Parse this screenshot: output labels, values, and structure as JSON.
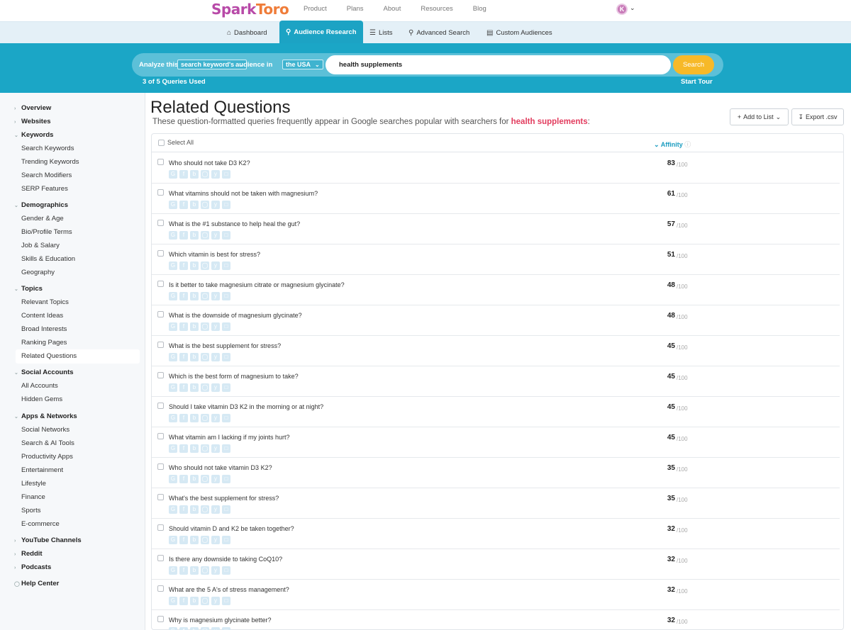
{
  "brand": {
    "logo_part1": "Spark",
    "logo_part2": "Toro"
  },
  "topnav": {
    "links": [
      "Product",
      "Plans",
      "About",
      "Resources",
      "Blog"
    ],
    "avatar_initial": "K"
  },
  "subnav": {
    "tabs": [
      {
        "label": "Dashboard",
        "icon": "home-icon",
        "active": false
      },
      {
        "label": "Audience Research",
        "icon": "user-search-icon",
        "active": true
      },
      {
        "label": "Lists",
        "icon": "list-icon",
        "active": false
      },
      {
        "label": "Advanced Search",
        "icon": "magnify-icon",
        "active": false
      },
      {
        "label": "Custom Audiences",
        "icon": "document-icon",
        "active": false
      }
    ]
  },
  "search": {
    "analyze_label": "Analyze this",
    "mode_value": "search keyword's",
    "audience_label": "audience in",
    "country_value": "the USA",
    "query": "health supplements",
    "button_label": "Search",
    "quota_text": "3 of 5 Queries Used",
    "tour_label": "Start Tour"
  },
  "sidebar": {
    "sections": [
      {
        "label": "Overview",
        "items": []
      },
      {
        "label": "Websites",
        "items": []
      },
      {
        "label": "Keywords",
        "items": [
          "Search Keywords",
          "Trending Keywords",
          "Search Modifiers",
          "SERP Features"
        ]
      },
      {
        "label": "Demographics",
        "items": [
          "Gender & Age",
          "Bio/Profile Terms",
          "Job & Salary",
          "Skills & Education",
          "Geography"
        ]
      },
      {
        "label": "Topics",
        "items": [
          "Relevant Topics",
          "Content Ideas",
          "Broad Interests",
          "Ranking Pages",
          "Related Questions"
        ]
      },
      {
        "label": "Social Accounts",
        "items": [
          "All Accounts",
          "Hidden Gems"
        ]
      },
      {
        "label": "Apps & Networks",
        "items": [
          "Social Networks",
          "Search & AI Tools",
          "Productivity Apps",
          "Entertainment",
          "Lifestyle",
          "Finance",
          "Sports",
          "E-commerce"
        ]
      },
      {
        "label": "YouTube Channels",
        "items": []
      },
      {
        "label": "Reddit",
        "items": []
      },
      {
        "label": "Podcasts",
        "items": []
      }
    ],
    "help_label": "Help Center",
    "active_item": "Related Questions"
  },
  "main": {
    "title": "Related Questions",
    "subtitle_prefix": "These question-formatted queries frequently appear in Google searches popular with searchers for ",
    "subtitle_keyword": "health supplements",
    "subtitle_suffix": ":",
    "add_to_list_label": "Add to List",
    "export_label": "Export .csv",
    "select_all_label": "Select All",
    "affinity_label": "Affinity",
    "outof_label": "/100"
  },
  "rows": [
    {
      "question": "Who should not take D3 K2?",
      "score": "83"
    },
    {
      "question": "What vitamins should not be taken with magnesium?",
      "score": "61"
    },
    {
      "question": "What is the #1 substance to help heal the gut?",
      "score": "57"
    },
    {
      "question": "Which vitamin is best for stress?",
      "score": "51"
    },
    {
      "question": "Is it better to take magnesium citrate or magnesium glycinate?",
      "score": "48"
    },
    {
      "question": "What is the downside of magnesium glycinate?",
      "score": "48"
    },
    {
      "question": "What is the best supplement for stress?",
      "score": "45"
    },
    {
      "question": "Which is the best form of magnesium to take?",
      "score": "45"
    },
    {
      "question": "Should I take vitamin D3 K2 in the morning or at night?",
      "score": "45"
    },
    {
      "question": "What vitamin am I lacking if my joints hurt?",
      "score": "45"
    },
    {
      "question": "Who should not take vitamin D3 K2?",
      "score": "35"
    },
    {
      "question": "What's the best supplement for stress?",
      "score": "35"
    },
    {
      "question": "Should vitamin D and K2 be taken together?",
      "score": "32"
    },
    {
      "question": "Is there any downside to taking CoQ10?",
      "score": "32"
    },
    {
      "question": "What are the 5 A's of stress management?",
      "score": "32"
    },
    {
      "question": "Why is magnesium glycinate better?",
      "score": "32"
    }
  ],
  "row_icon_names": [
    "google-icon",
    "facebook-icon",
    "bing-icon",
    "duckduckgo-icon",
    "yahoo-icon",
    "copy-icon"
  ]
}
